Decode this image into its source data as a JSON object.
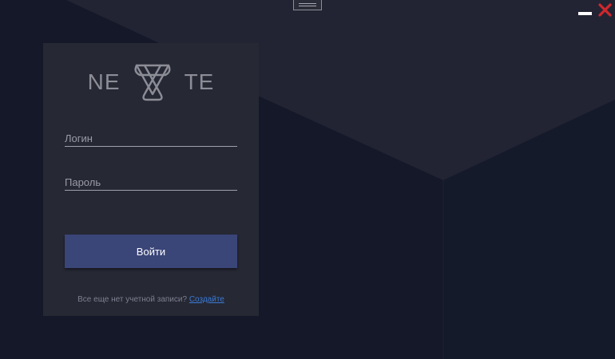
{
  "window": {
    "title_controls": [
      "drag-handle",
      "minimize",
      "close"
    ],
    "close_color": "#d0282c"
  },
  "logo": {
    "left_text": "NE",
    "right_text": "TE",
    "icon": "triangle-knot-icon"
  },
  "form": {
    "login_placeholder": "Логин",
    "password_placeholder": "Пароль",
    "submit_label": "Войти"
  },
  "register": {
    "prompt": "Все еще нет учетной записи?",
    "link_label": "Создайте"
  },
  "colors": {
    "background": "#141829",
    "card": "#262834",
    "button": "#3a4578",
    "link": "#3a7bd5"
  }
}
